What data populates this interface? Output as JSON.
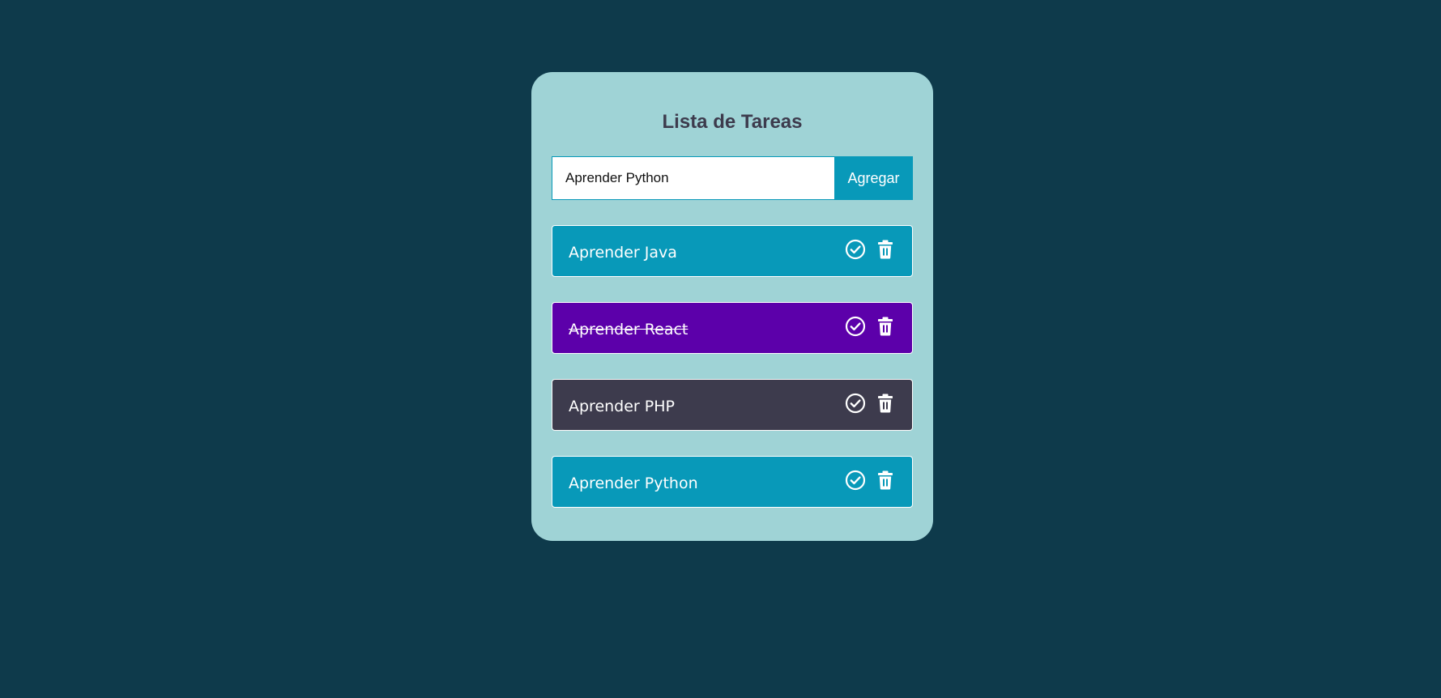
{
  "app": {
    "title": "Lista de Tareas"
  },
  "form": {
    "input_value": "Aprender Python",
    "add_label": "Agregar"
  },
  "colors": {
    "background": "#0e3a4b",
    "card": "#9fd3d6",
    "title": "#3d3b4d",
    "accent": "#0899b9"
  },
  "tasks": [
    {
      "label": "Aprender Java",
      "completed": false,
      "color": "#0899b9",
      "icons": [
        "check-circle-icon",
        "trash-icon"
      ]
    },
    {
      "label": "Aprender React",
      "completed": true,
      "color": "#5c00aa",
      "icons": [
        "check-circle-icon",
        "trash-icon"
      ]
    },
    {
      "label": "Aprender PHP",
      "completed": false,
      "color": "#3d3b4d",
      "icons": [
        "check-circle-icon",
        "trash-icon"
      ]
    },
    {
      "label": "Aprender Python",
      "completed": false,
      "color": "#0899b9",
      "icons": [
        "check-circle-icon",
        "trash-icon"
      ]
    }
  ]
}
